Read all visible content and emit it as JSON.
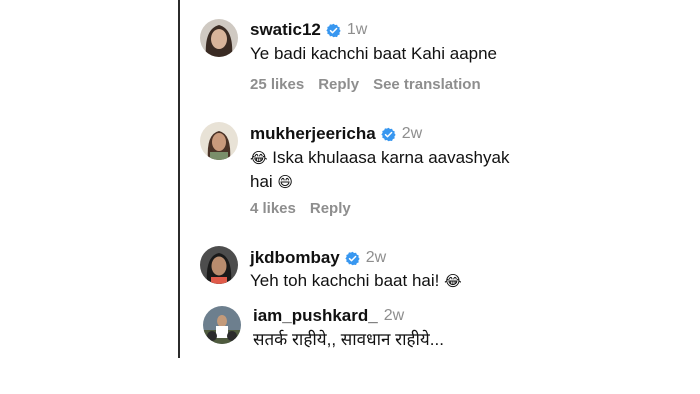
{
  "comments": [
    {
      "username": "swatic12",
      "time": "1w",
      "text": "Ye badi kachchi baat Kahi aapne",
      "likes": "25 likes",
      "reply": "Reply",
      "translation": "See translation"
    },
    {
      "username": "mukherjeericha",
      "time": "2w",
      "emoji_a": "😂",
      "text_line1": "Iska khulaasa karna aavashyak",
      "text_line2": "hai",
      "emoji_b": "😄",
      "likes": "4 likes",
      "reply": "Reply"
    },
    {
      "username": "jkdbombay",
      "time": "2w",
      "text": "Yeh toh kachchi baat hai!",
      "emoji": "😂"
    },
    {
      "username": "iam_pushkard_",
      "time": "2w",
      "text": "सतर्क राहीये,, सावधान राहीये..."
    }
  ],
  "icons": {
    "verified_color": "#3897f0"
  }
}
